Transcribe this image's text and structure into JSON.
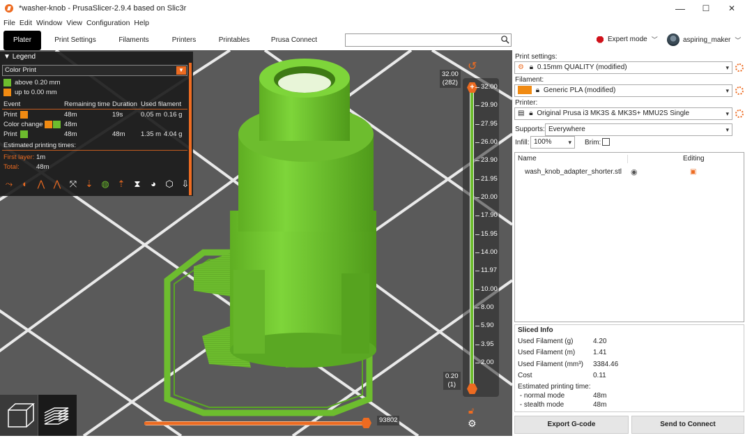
{
  "window": {
    "title": "*washer-knob - PrusaSlicer-2.9.4 based on Slic3r",
    "minimize": "—",
    "maximize": "☐",
    "close": "✕"
  },
  "menu": [
    "File",
    "Edit",
    "Window",
    "View",
    "Configuration",
    "Help"
  ],
  "tabs": [
    "Plater",
    "Print Settings",
    "Filaments",
    "Printers",
    "Printables",
    "Prusa Connect"
  ],
  "search": {
    "placeholder": ""
  },
  "mode": {
    "label": "Expert mode",
    "color": "#d0121b"
  },
  "user": {
    "name": "aspiring_maker"
  },
  "legend": {
    "title": "Legend",
    "view_type": "Color Print",
    "ranges": [
      {
        "label": "above 0.20 mm",
        "color": "#6dbd2e"
      },
      {
        "label": "up to 0.00 mm",
        "color": "#f08a12"
      }
    ],
    "columns": [
      "Event",
      "Remaining time",
      "Duration",
      "Used filament"
    ],
    "rows": [
      {
        "event": "Print",
        "colors": [
          "#f08a12"
        ],
        "remaining": "48m",
        "duration": "19s",
        "length": "0.05 m",
        "weight": "0.16 g"
      },
      {
        "event": "Color change",
        "colors": [
          "#f08a12",
          "#6dbd2e"
        ],
        "remaining": "48m",
        "duration": "",
        "length": "",
        "weight": ""
      },
      {
        "event": "Print",
        "colors": [
          "#6dbd2e"
        ],
        "remaining": "48m",
        "duration": "48m",
        "length": "1.35 m",
        "weight": "4.04 g"
      }
    ],
    "estimated_label": "Estimated printing times:",
    "first_layer_label": "First layer:",
    "first_layer_value": "1m",
    "total_label": "Total:",
    "total_value": "48m"
  },
  "layer_slider": {
    "top_value": "32.00",
    "top_layer": "(282)",
    "bottom_value": "0.20",
    "bottom_layer": "(1)",
    "ticks": [
      "32.00",
      "29.90",
      "27.95",
      "26.00",
      "23.90",
      "21.95",
      "20.00",
      "17.90",
      "15.95",
      "14.00",
      "11.97",
      "10.00",
      "8.00",
      "5.90",
      "3.95",
      "2.00"
    ]
  },
  "move_slider": {
    "value": "93802",
    "fraction": 1.0
  },
  "panel": {
    "print_label": "Print settings:",
    "print_value": "0.15mm QUALITY (modified)",
    "filament_label": "Filament:",
    "filament_value": "Generic PLA (modified)",
    "filament_color": "#f08a12",
    "printer_label": "Printer:",
    "printer_value": "Original Prusa i3 MK3S & MK3S+ MMU2S Single",
    "supports_label": "Supports:",
    "supports_value": "Everywhere",
    "infill_label": "Infill:",
    "infill_value": "100%",
    "brim_label": "Brim:",
    "brim_checked": false,
    "objects_col_name": "Name",
    "objects_col_editing": "Editing",
    "objects": [
      {
        "name": "wash_knob_adapter_shorter.stl"
      }
    ]
  },
  "sliced_info": {
    "title": "Sliced Info",
    "rows": [
      {
        "label": "Used Filament (g)",
        "value": "4.20"
      },
      {
        "label": "Used Filament (m)",
        "value": "1.41"
      },
      {
        "label": "Used Filament (mm³)",
        "value": "3384.46"
      },
      {
        "label": "Cost",
        "value": "0.11"
      },
      {
        "label": "Estimated printing time:",
        "value": ""
      },
      {
        "label": " - normal mode",
        "value": "48m"
      },
      {
        "label": " - stealth mode",
        "value": "48m"
      }
    ]
  },
  "buttons": {
    "export": "Export G-code",
    "send": "Send to Connect"
  },
  "colors": {
    "accent": "#ed6b21",
    "model": "#6dbd2e",
    "viewport": "#5a5a5a"
  }
}
